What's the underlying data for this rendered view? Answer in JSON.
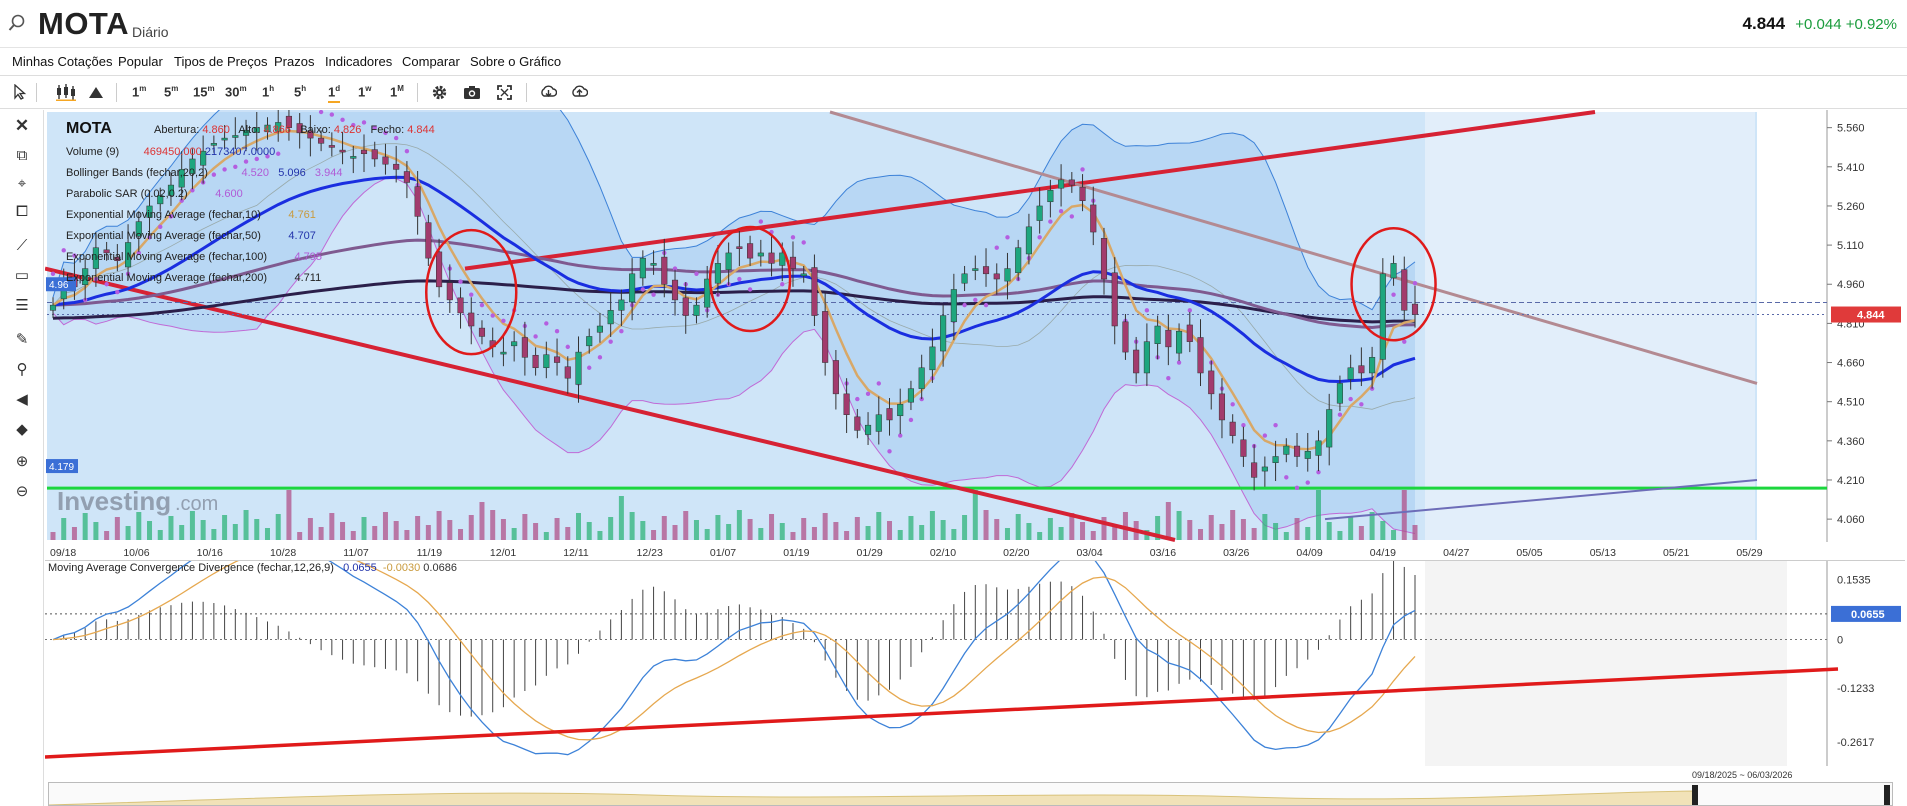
{
  "header": {
    "symbol": "MOTA",
    "period": "Diário",
    "price": "4.844",
    "change": "+0.044 +0.92%"
  },
  "menu": {
    "items": [
      "Minhas Cotações",
      "Popular",
      "Tipos de Preços",
      "Prazos",
      "Indicadores",
      "Comparar",
      "Sobre o Gráfico"
    ]
  },
  "toolbar": {
    "timeframes": [
      {
        "label": "1",
        "unit": "m"
      },
      {
        "label": "5",
        "unit": "m"
      },
      {
        "label": "15",
        "unit": "m"
      },
      {
        "label": "30",
        "unit": "m"
      },
      {
        "label": "1",
        "unit": "h"
      },
      {
        "label": "5",
        "unit": "h"
      },
      {
        "label": "1",
        "unit": "d"
      },
      {
        "label": "1",
        "unit": "w"
      },
      {
        "label": "1",
        "unit": "M"
      }
    ],
    "selected": "1d",
    "icons": [
      "cursor-icon",
      "candles-icon",
      "mountain-icon",
      "gear-icon",
      "camera-icon",
      "fullscreen-icon",
      "download-icon",
      "upload-icon"
    ]
  },
  "legend": {
    "title": "MOTA",
    "ohlc": {
      "open_label": "Abertura:",
      "open": "4.860",
      "high_label": "Alto:",
      "high": "4.866",
      "low_label": "Baixo:",
      "low": "4.826",
      "close_label": "Fecho:",
      "close": "4.844"
    },
    "volume": {
      "name": "Volume (9)",
      "v1": "469450.000",
      "v2": "2173407.0000"
    },
    "bollinger": {
      "name": "Bollinger Bands (fechar,20,2)",
      "v1": "4.520",
      "v2": "5.096",
      "v3": "3.944"
    },
    "sar": {
      "name": "Parabolic SAR (0.02,0.2)",
      "v1": "4.600"
    },
    "ema10": {
      "name": "Exponential Moving Average (fechar,10)",
      "v1": "4.761"
    },
    "ema50": {
      "name": "Exponential Moving Average (fechar,50)",
      "v1": "4.707"
    },
    "ema100": {
      "name": "Exponential Moving Average (fechar,100)",
      "v1": "4.795"
    },
    "ema200": {
      "name": "Exponential Moving Average (fechar,200)",
      "v1": "4.711"
    }
  },
  "chart_data": {
    "type": "candlestick",
    "yticks": [
      "5.560",
      "5.410",
      "5.260",
      "5.110",
      "4.960",
      "4.810",
      "4.660",
      "4.510",
      "4.360",
      "4.210",
      "4.060"
    ],
    "ylim": [
      3.98,
      5.62
    ],
    "x_labels": [
      "09/18",
      "10/06",
      "10/16",
      "10/28",
      "11/07",
      "11/19",
      "12/01",
      "12/11",
      "12/23",
      "01/07",
      "01/19",
      "01/29",
      "02/10",
      "02/20",
      "03/04",
      "03/16",
      "03/26",
      "04/09",
      "04/19",
      "04/27",
      "05/05",
      "05/13",
      "05/21",
      "05/29"
    ],
    "year_labels": [
      "2025",
      "2026"
    ],
    "last_price_tag": "4.844",
    "left_tags": [
      "4.96",
      "4.179"
    ],
    "horizontal_support": 4.179,
    "closes": [
      4.88,
      4.97,
      4.95,
      5.02,
      5.1,
      5.08,
      5.05,
      5.12,
      5.2,
      5.26,
      5.3,
      5.34,
      5.4,
      5.44,
      5.47,
      5.5,
      5.52,
      5.53,
      5.55,
      5.56,
      5.57,
      5.58,
      5.56,
      5.54,
      5.52,
      5.5,
      5.49,
      5.47,
      5.45,
      5.46,
      5.44,
      5.42,
      5.4,
      5.35,
      5.22,
      5.06,
      4.95,
      4.9,
      4.85,
      4.8,
      4.76,
      4.72,
      4.7,
      4.74,
      4.68,
      4.64,
      4.69,
      4.66,
      4.6,
      4.7,
      4.76,
      4.8,
      4.86,
      4.9,
      5.0,
      5.06,
      5.04,
      4.96,
      4.9,
      4.84,
      4.88,
      4.98,
      5.04,
      5.08,
      5.1,
      5.06,
      5.08,
      5.04,
      5.08,
      5.02,
      5.0,
      4.84,
      4.66,
      4.54,
      4.46,
      4.4,
      4.42,
      4.46,
      4.44,
      4.5,
      4.56,
      4.64,
      4.72,
      4.84,
      4.94,
      5.0,
      5.02,
      5.0,
      4.98,
      5.02,
      5.1,
      5.18,
      5.26,
      5.32,
      5.36,
      5.34,
      5.28,
      5.16,
      4.98,
      4.8,
      4.7,
      4.62,
      4.74,
      4.8,
      4.72,
      4.78,
      4.74,
      4.62,
      4.54,
      4.44,
      4.38,
      4.3,
      4.22,
      4.26,
      4.3,
      4.34,
      4.3,
      4.32,
      4.36,
      4.48,
      4.58,
      4.64,
      4.62,
      4.68,
      5.0,
      5.04,
      4.86,
      4.844
    ]
  },
  "macd": {
    "title": "Moving Average Convergence Divergence (fechar,12,26,9)",
    "v1": "0.0655",
    "v2": "-0.0030",
    "v3": "0.0686",
    "yticks": [
      "0.1535",
      "0",
      "-0.1233",
      "-0.2617"
    ],
    "tag": "0.0655"
  },
  "watermark": {
    "brand": "Investing",
    "domain": ".com"
  },
  "navigator": {
    "range": "09/18/2025 ~ 06/03/2026"
  },
  "colors": {
    "candle_up": "#1ea67e",
    "candle_down": "#a23b6d",
    "ema50": "#1a2ee0",
    "ema200": "#2b1f4a",
    "ema10": "#d8a868",
    "ema100": "#7f5a90",
    "sar": "#b45ee0",
    "support": "#1cd63e",
    "trend_red": "#d62234",
    "trend_brown": "#b38a92"
  }
}
